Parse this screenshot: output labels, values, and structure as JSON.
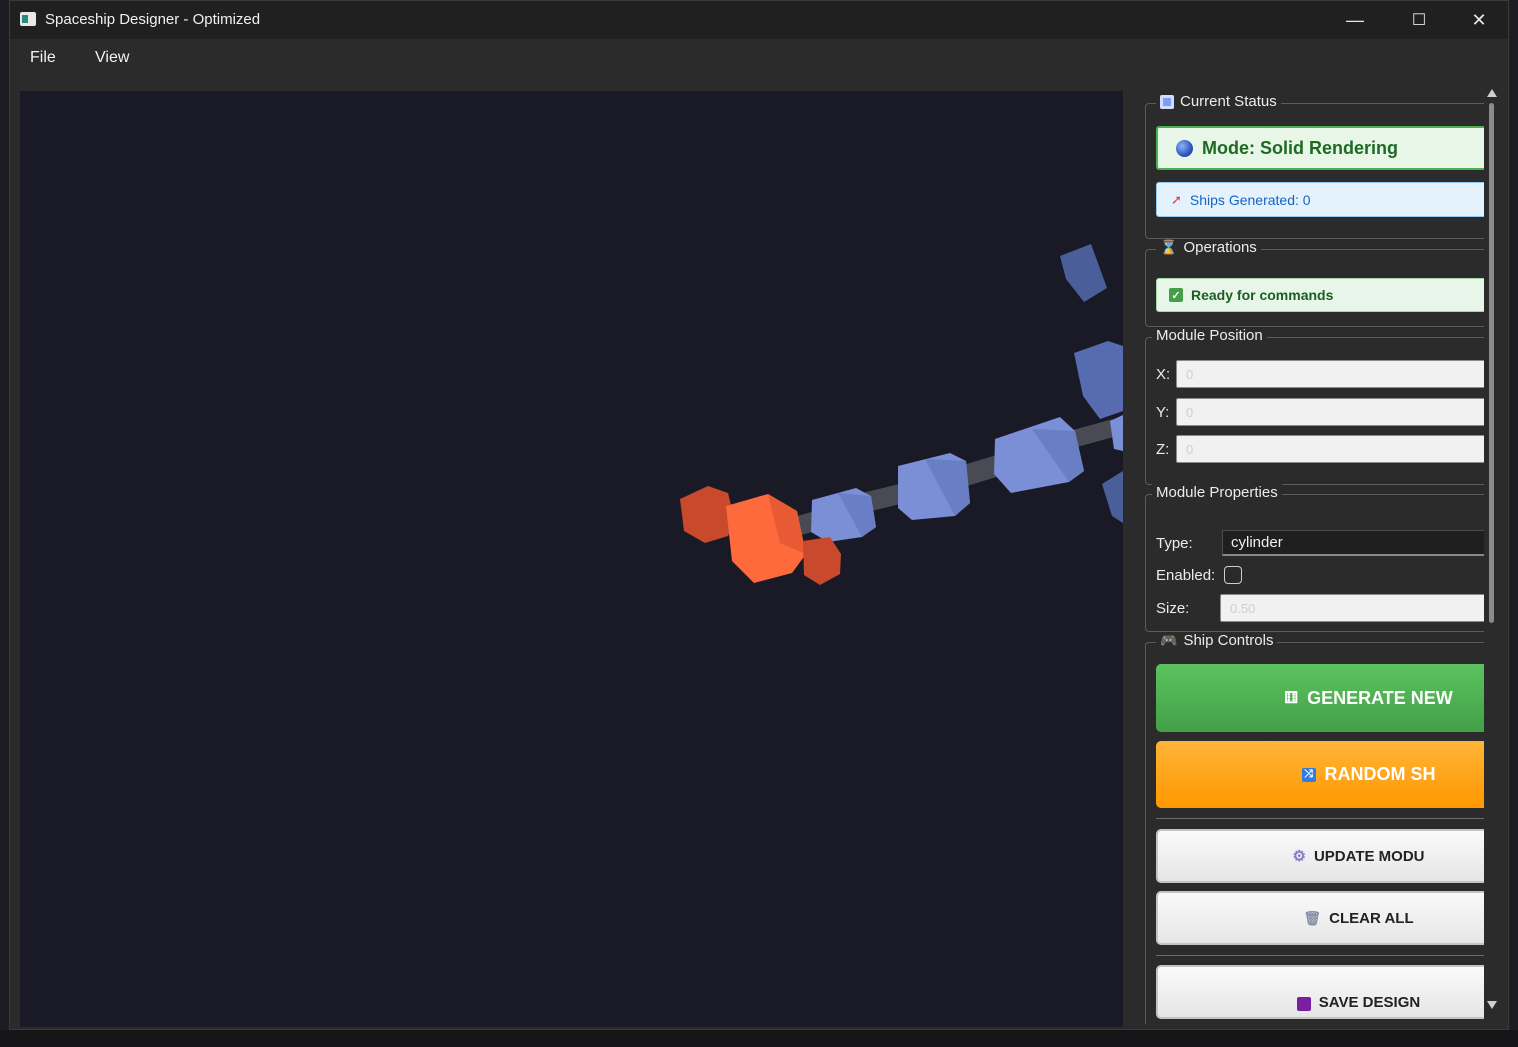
{
  "window": {
    "title": "Spaceship Designer - Optimized",
    "controls": {
      "minimize": "—",
      "maximize": "☐",
      "close": "✕"
    }
  },
  "menu": {
    "file": "File",
    "view": "View"
  },
  "viewport": {
    "colors": {
      "background": "#1a1a26",
      "engine": "#ff6a3d",
      "engine_dark": "#c9492d",
      "hull": "#7b8fd6",
      "hull_dark": "#4a5f99",
      "strut": "#4a4a55"
    }
  },
  "status": {
    "title": "Current Status",
    "mode": "Mode: Solid Rendering",
    "ships": "Ships Generated: 0"
  },
  "operations": {
    "title": "Operations",
    "message": "Ready for commands"
  },
  "position": {
    "title": "Module Position",
    "x_label": "X:",
    "x_value": "0",
    "y_label": "Y:",
    "y_value": "0",
    "z_label": "Z:",
    "z_value": "0"
  },
  "properties": {
    "title": "Module Properties",
    "type_label": "Type:",
    "type_value": "cylinder",
    "enabled_label": "Enabled:",
    "enabled": false,
    "size_label": "Size:",
    "size_value": "0.50"
  },
  "controls": {
    "title": "Ship Controls",
    "generate_label": "GENERATE NEW",
    "random_label": "RANDOM SH",
    "update_label": "UPDATE MODU",
    "clear_label": "CLEAR ALL",
    "save_label": "SAVE DESIGN"
  },
  "icons": {
    "status": "dashboard-icon",
    "mode": "sphere-icon",
    "ships": "rocket-icon",
    "operations": "hourglass-icon",
    "ready": "checkmark-icon",
    "controls": "gamepad-icon",
    "generate": "dice-icon",
    "random": "shuffle-icon",
    "update": "gear-icon",
    "clear": "trash-icon",
    "save": "floppy-disk-icon"
  }
}
